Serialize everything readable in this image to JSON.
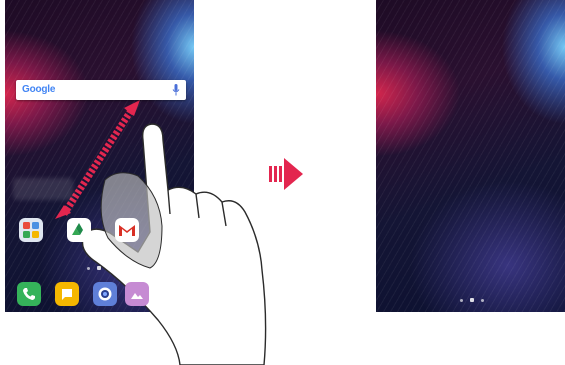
{
  "left_screen": {
    "search_bar": {
      "logo_text": "Google",
      "mic_icon": "microphone-icon"
    },
    "home_row_apps": [
      "folder-icon",
      "drive-icon",
      "gmail-icon"
    ],
    "dock_apps": [
      "phone-icon",
      "messages-icon",
      "camera-icon",
      "gallery-icon"
    ],
    "gesture": "pinch-out"
  },
  "transition_arrow": {
    "icon": "right-arrow-icon",
    "color": "#e3264f"
  },
  "right_screen": {
    "content": "wallpaper-only"
  },
  "colors": {
    "accent_red": "#e3264f",
    "hand_outline": "#2b2b2b"
  }
}
